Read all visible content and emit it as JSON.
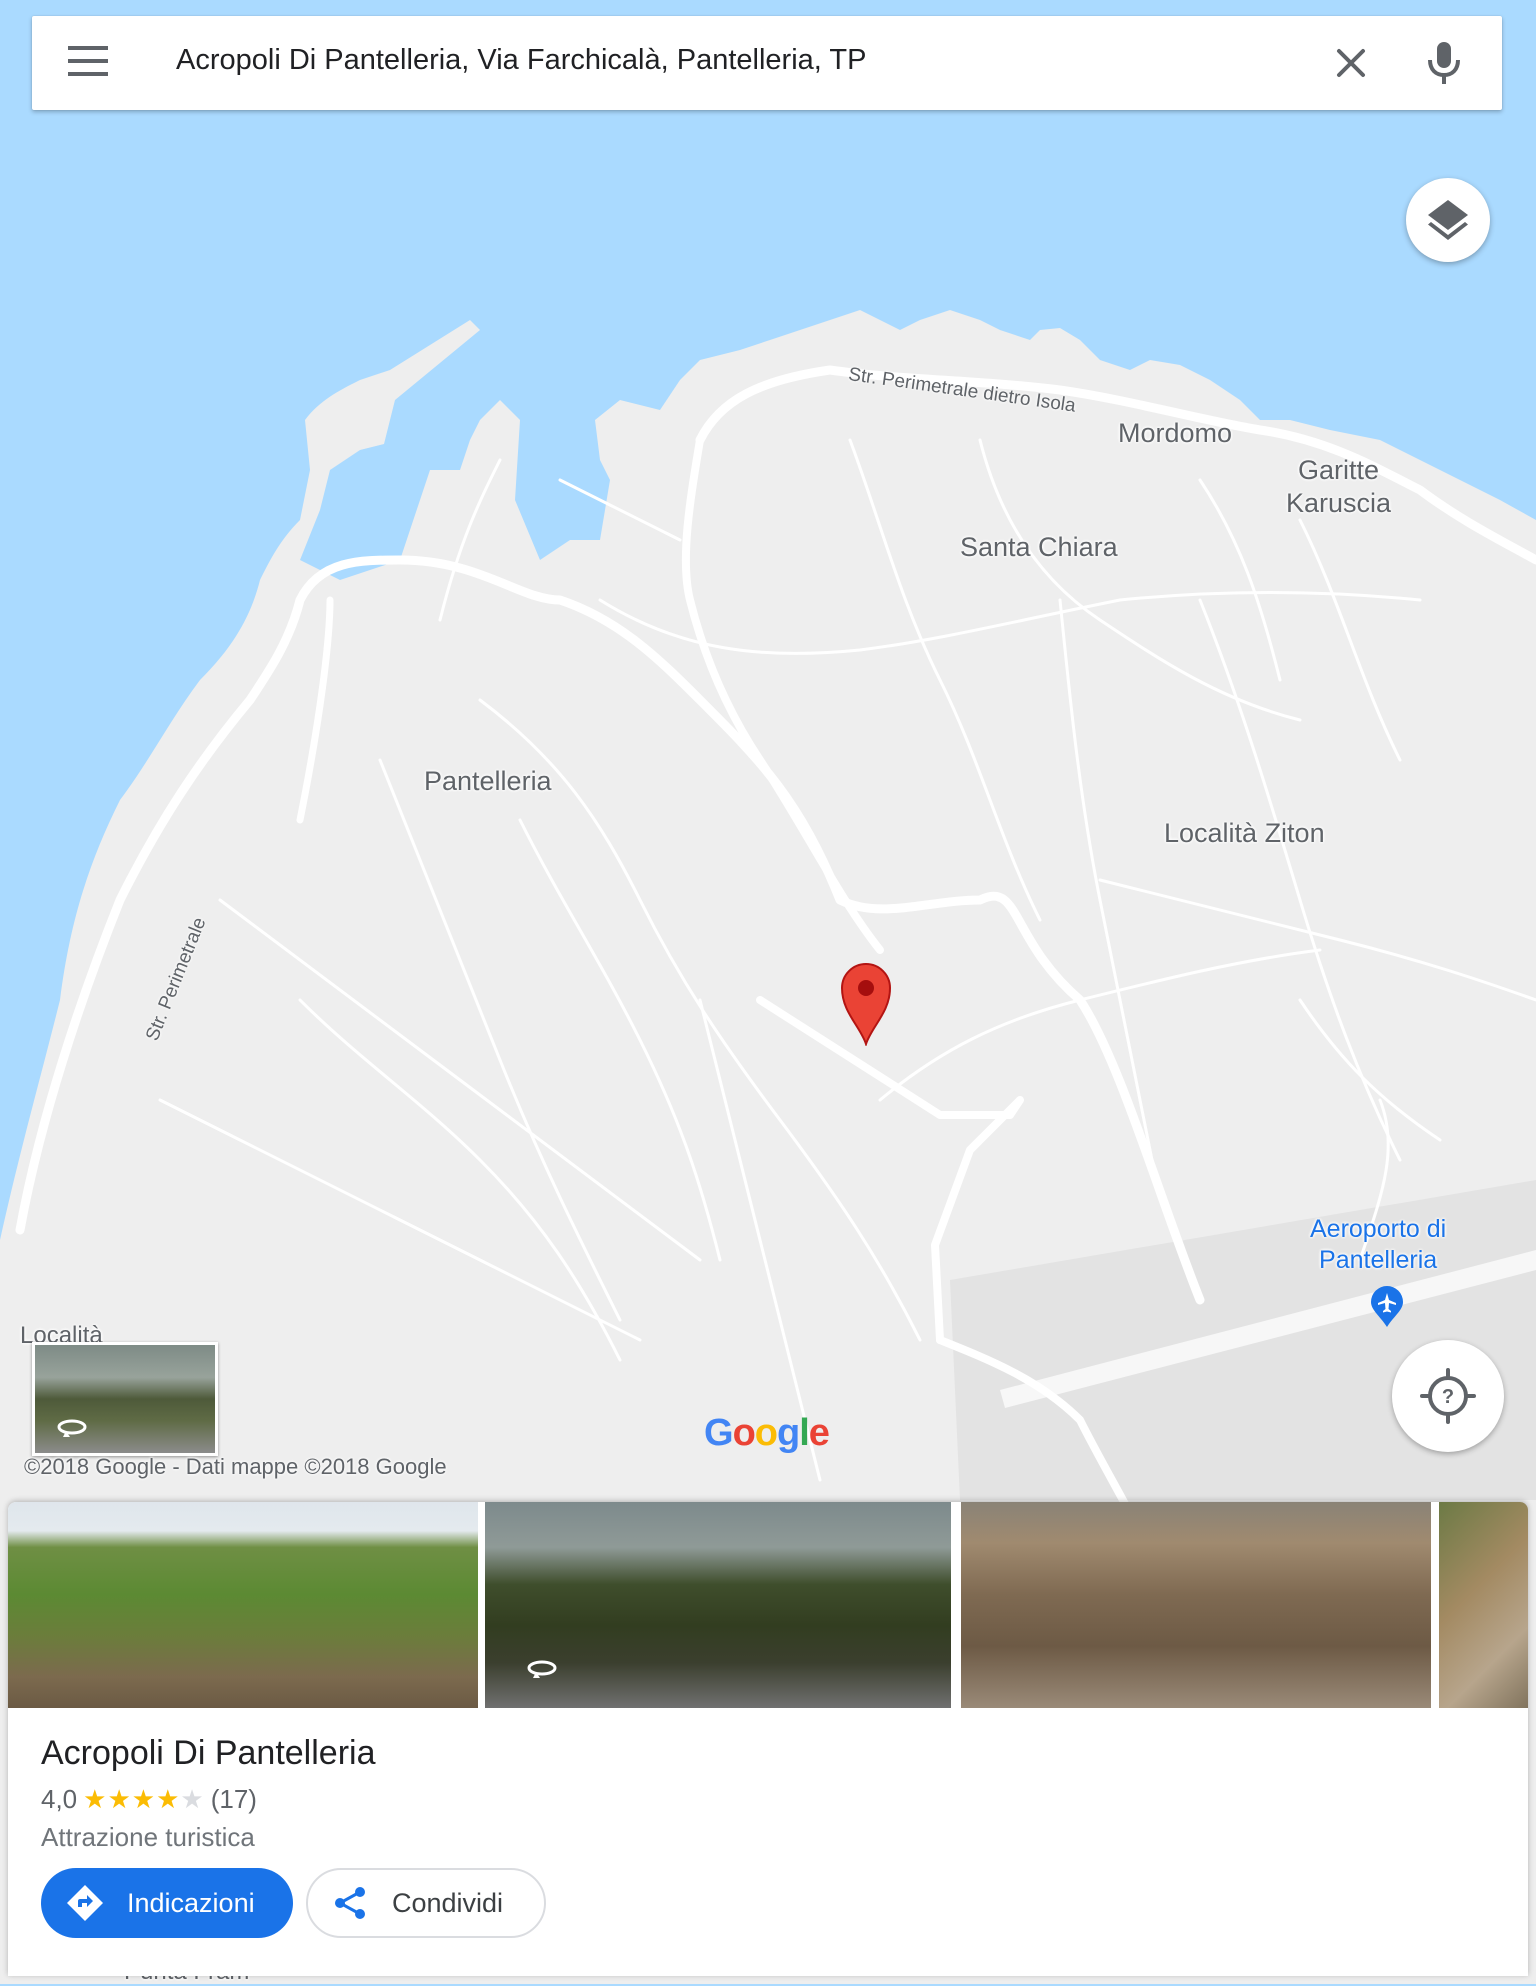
{
  "search": {
    "query": "Acropoli Di Pantelleria, Via Farchicalà, Pantelleria, TP"
  },
  "map": {
    "water_color": "#aadaff",
    "land_color": "#eeeeee",
    "road_color": "#ffffff",
    "marker_color": "#ea4335",
    "icons": [
      "menu-icon",
      "close-icon",
      "mic-icon",
      "layers-icon",
      "locate-icon",
      "airport-icon",
      "location-pin-icon",
      "street-view-icon"
    ],
    "places": {
      "mordomo": "Mordomo",
      "garitte": "Garitte\nKaruscia",
      "santa_chiara": "Santa Chiara",
      "pantelleria": "Pantelleria",
      "ziton": "Località Ziton",
      "airport": "Aeroporto di\nPantelleria",
      "localita_partial": "Località",
      "punta_partial": "Punta Fram"
    },
    "roads": {
      "north": "Str. Perimetrale dietro Isola",
      "west": "Str. Perimetrale"
    },
    "logo": "Google",
    "copyright": "©2018 Google - Dati mappe ©2018 Google"
  },
  "place": {
    "name": "Acropoli Di Pantelleria",
    "rating": "4,0",
    "rating_value": 4.0,
    "rating_max": 5,
    "review_count": "(17)",
    "category": "Attrazione turistica",
    "photo_count_visible": 4
  },
  "actions": {
    "directions_label": "Indicazioni",
    "share_label": "Condividi"
  }
}
